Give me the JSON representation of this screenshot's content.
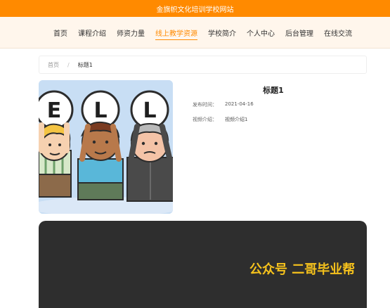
{
  "site_title": "金旗帜文化培训学校网站",
  "nav": {
    "items": [
      "首页",
      "课程介绍",
      "师资力量",
      "线上教学资源",
      "学校简介",
      "个人中心",
      "后台管理",
      "在线交流"
    ],
    "active_index": 3
  },
  "breadcrumb": {
    "home": "首页",
    "separator": "/",
    "current": "标题1"
  },
  "cover": {
    "letters": [
      "E",
      "L",
      "L"
    ],
    "icon": "cartoon-characters-holding-letter-signs"
  },
  "detail": {
    "title": "标题1",
    "publish_label": "发布时间：",
    "publish_value": "2021-04-16",
    "intro_label": "视频介绍：",
    "intro_value": "视频介绍1"
  },
  "video": {
    "watermark": "公众号 二哥毕业帮"
  },
  "colors": {
    "brand": "#ff8a00",
    "nav_bg": "#fff6ec",
    "video_bg": "#2e2e2e",
    "watermark": "#f6c21c"
  }
}
